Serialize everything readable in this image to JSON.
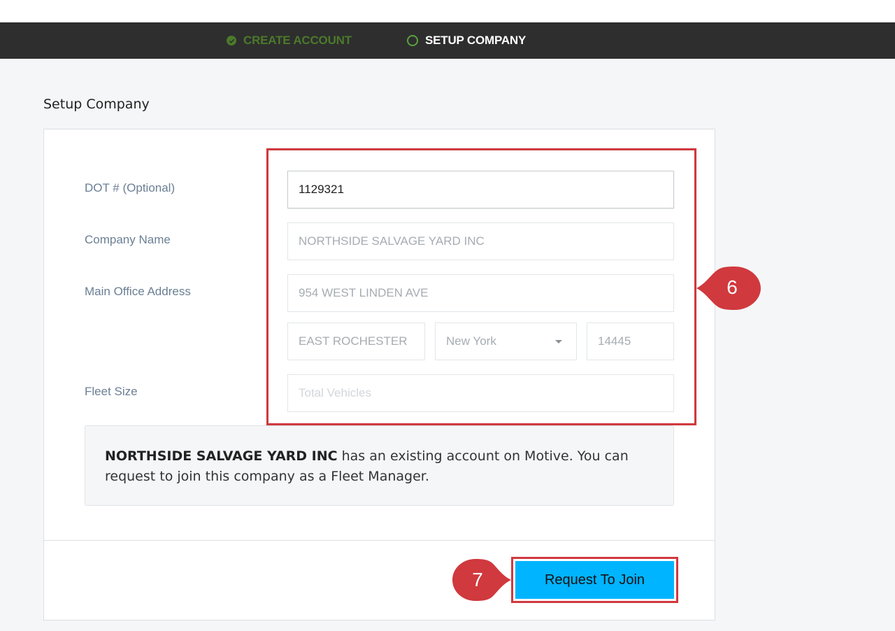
{
  "steps": {
    "create_account": "CREATE ACCOUNT",
    "setup_company": "SETUP COMPANY"
  },
  "page_title": "Setup Company",
  "form": {
    "dot_label": "DOT # (Optional)",
    "dot_value": "1129321",
    "company_name_label": "Company Name",
    "company_name_value": "NORTHSIDE SALVAGE YARD INC",
    "address_label": "Main Office Address",
    "address_value": "954 WEST LINDEN AVE",
    "city_value": "EAST ROCHESTER",
    "state_value": "New York",
    "zip_value": "14445",
    "fleet_size_label": "Fleet Size",
    "fleet_size_placeholder": "Total Vehicles"
  },
  "notice": {
    "company": "NORTHSIDE SALVAGE YARD INC",
    "message": " has an existing account on Motive. You can request to join this company as a Fleet Manager."
  },
  "actions": {
    "request_join_label": "Request To Join"
  },
  "callouts": {
    "fields_number": "6",
    "button_number": "7",
    "color": "#d0393e"
  },
  "colors": {
    "accent_button": "#00b4ff",
    "step_done": "#4b7a2b",
    "topbar": "#2e2e2e"
  }
}
